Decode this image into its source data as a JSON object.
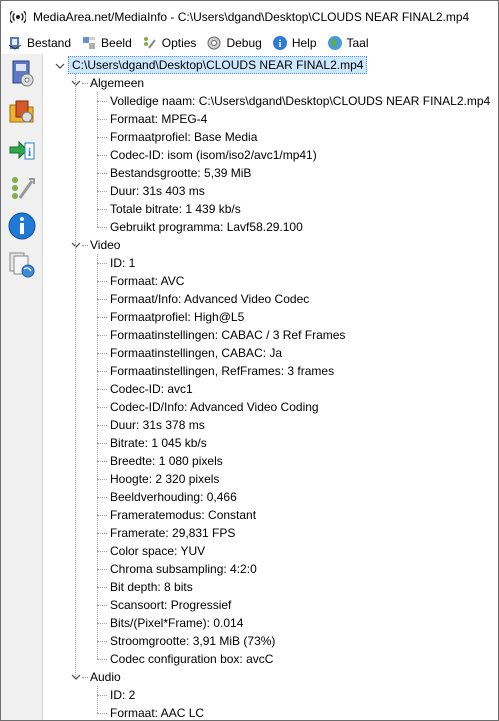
{
  "window": {
    "title": "MediaArea.net/MediaInfo - C:\\Users\\dgand\\Desktop\\CLOUDS NEAR FINAL2.mp4"
  },
  "menu": [
    {
      "label": "Bestand",
      "icon": "folder-icon"
    },
    {
      "label": "Beeld",
      "icon": "view-icon"
    },
    {
      "label": "Opties",
      "icon": "options-icon"
    },
    {
      "label": "Debug",
      "icon": "debug-icon"
    },
    {
      "label": "Help",
      "icon": "help-icon"
    },
    {
      "label": "Taal",
      "icon": "language-icon"
    }
  ],
  "toolbar": [
    {
      "icon": "open-file-icon"
    },
    {
      "icon": "open-folder-icon"
    },
    {
      "icon": "export-icon"
    },
    {
      "icon": "settings-icon"
    },
    {
      "icon": "info-icon"
    },
    {
      "icon": "about-icon"
    }
  ],
  "tree": {
    "root": "C:\\Users\\dgand\\Desktop\\CLOUDS NEAR FINAL2.mp4",
    "sections": [
      {
        "name": "Algemeen",
        "items": [
          "Volledige naam: C:\\Users\\dgand\\Desktop\\CLOUDS NEAR FINAL2.mp4",
          "Formaat: MPEG-4",
          "Formaatprofiel: Base Media",
          "Codec-ID: isom (isom/iso2/avc1/mp41)",
          "Bestandsgrootte: 5,39 MiB",
          "Duur: 31s 403 ms",
          "Totale bitrate: 1 439 kb/s",
          "Gebruikt programma: Lavf58.29.100"
        ]
      },
      {
        "name": "Video",
        "items": [
          "ID: 1",
          "Formaat: AVC",
          "Formaat/Info: Advanced Video Codec",
          "Formaatprofiel: High@L5",
          "Formaatinstellingen: CABAC / 3 Ref Frames",
          "Formaatinstellingen, CABAC: Ja",
          "Formaatinstellingen, RefFrames: 3 frames",
          "Codec-ID: avc1",
          "Codec-ID/Info: Advanced Video Coding",
          "Duur: 31s 378 ms",
          "Bitrate: 1 045 kb/s",
          "Breedte: 1 080 pixels",
          "Hoogte: 2 320 pixels",
          "Beeldverhouding: 0,466",
          "Frameratemodus: Constant",
          "Framerate: 29,831 FPS",
          "Color space: YUV",
          "Chroma subsampling: 4:2:0",
          "Bit depth: 8 bits",
          "Scansoort: Progressief",
          "Bits/(Pixel*Frame): 0.014",
          "Stroomgrootte: 3,91 MiB (73%)",
          "Codec configuration box: avcC"
        ]
      },
      {
        "name": "Audio",
        "items": [
          "ID: 2",
          "Formaat: AAC LC"
        ]
      }
    ]
  }
}
